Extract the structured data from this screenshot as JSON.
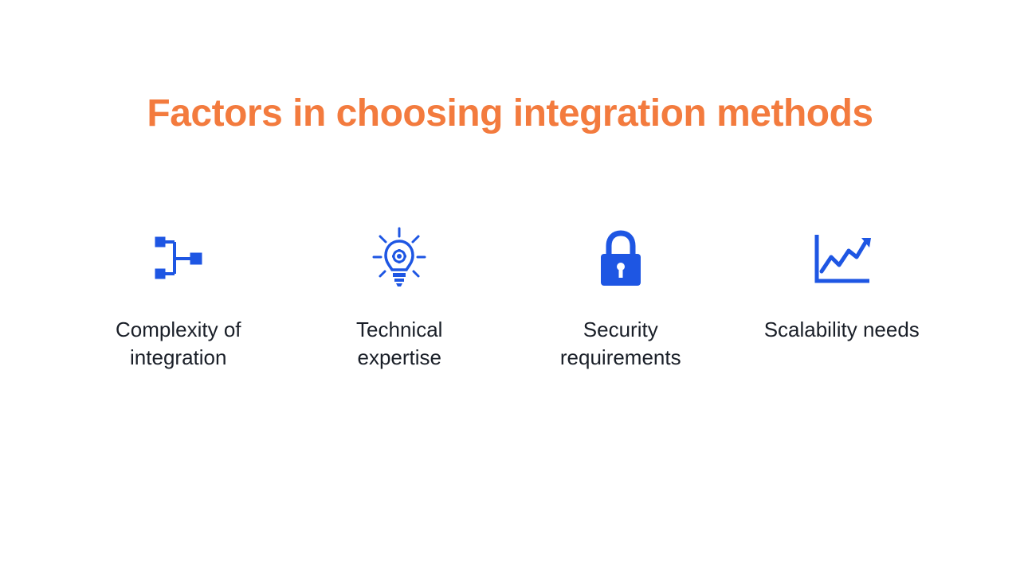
{
  "title": "Factors in choosing integration methods",
  "iconColor": "#1e56e3",
  "items": [
    {
      "label": "Complexity of integration",
      "icon": "hierarchy"
    },
    {
      "label": "Technical expertise",
      "icon": "lightbulb"
    },
    {
      "label": "Security requirements",
      "icon": "lock"
    },
    {
      "label": "Scalability needs",
      "icon": "chart"
    }
  ]
}
